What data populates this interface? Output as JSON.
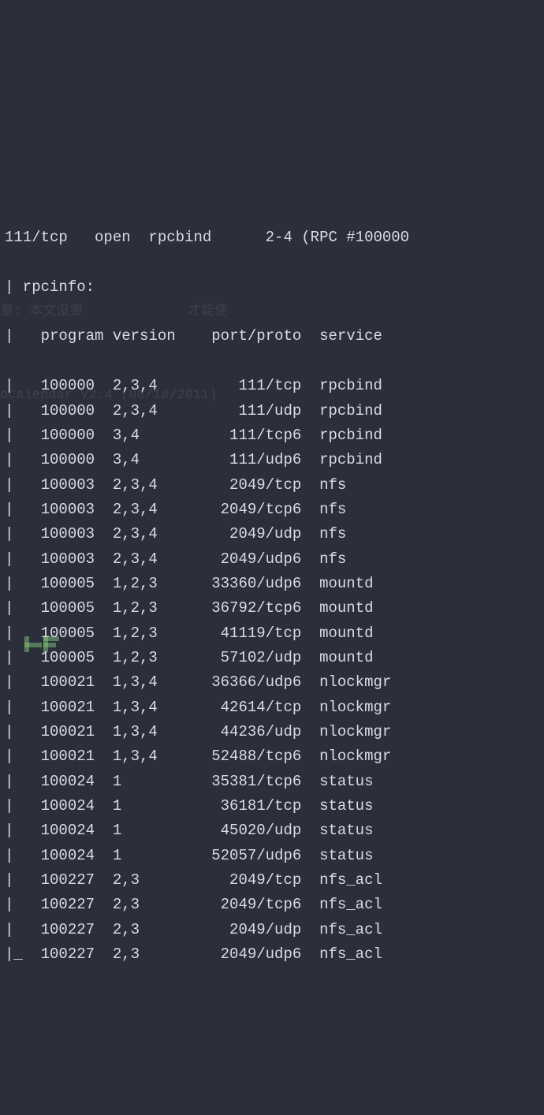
{
  "header": "111/tcp   open  rpcbind      2-4 (RPC #100000",
  "subheader": "| rpcinfo: ",
  "col": {
    "program": "program",
    "version": "version",
    "portproto": "port/proto",
    "service": "service"
  },
  "rows": [
    {
      "program": "100000",
      "version": "2,3,4",
      "portproto": "111/tcp",
      "service": "rpcbind"
    },
    {
      "program": "100000",
      "version": "2,3,4",
      "portproto": "111/udp",
      "service": "rpcbind"
    },
    {
      "program": "100000",
      "version": "3,4",
      "portproto": "111/tcp6",
      "service": "rpcbind"
    },
    {
      "program": "100000",
      "version": "3,4",
      "portproto": "111/udp6",
      "service": "rpcbind"
    },
    {
      "program": "100003",
      "version": "2,3,4",
      "portproto": "2049/tcp",
      "service": "nfs"
    },
    {
      "program": "100003",
      "version": "2,3,4",
      "portproto": "2049/tcp6",
      "service": "nfs"
    },
    {
      "program": "100003",
      "version": "2,3,4",
      "portproto": "2049/udp",
      "service": "nfs"
    },
    {
      "program": "100003",
      "version": "2,3,4",
      "portproto": "2049/udp6",
      "service": "nfs"
    },
    {
      "program": "100005",
      "version": "1,2,3",
      "portproto": "33360/udp6",
      "service": "mountd"
    },
    {
      "program": "100005",
      "version": "1,2,3",
      "portproto": "36792/tcp6",
      "service": "mountd"
    },
    {
      "program": "100005",
      "version": "1,2,3",
      "portproto": "41119/tcp",
      "service": "mountd"
    },
    {
      "program": "100005",
      "version": "1,2,3",
      "portproto": "57102/udp",
      "service": "mountd"
    },
    {
      "program": "100021",
      "version": "1,3,4",
      "portproto": "36366/udp6",
      "service": "nlockmgr"
    },
    {
      "program": "100021",
      "version": "1,3,4",
      "portproto": "42614/tcp",
      "service": "nlockmgr"
    },
    {
      "program": "100021",
      "version": "1,3,4",
      "portproto": "44236/udp",
      "service": "nlockmgr"
    },
    {
      "program": "100021",
      "version": "1,3,4",
      "portproto": "52488/tcp6",
      "service": "nlockmgr"
    },
    {
      "program": "100024",
      "version": "1",
      "portproto": "35381/tcp6",
      "service": "status"
    },
    {
      "program": "100024",
      "version": "1",
      "portproto": "36181/tcp",
      "service": "status"
    },
    {
      "program": "100024",
      "version": "1",
      "portproto": "45020/udp",
      "service": "status"
    },
    {
      "program": "100024",
      "version": "1",
      "portproto": "52057/udp6",
      "service": "status"
    },
    {
      "program": "100227",
      "version": "2,3",
      "portproto": "2049/tcp",
      "service": "nfs_acl"
    },
    {
      "program": "100227",
      "version": "2,3",
      "portproto": "2049/tcp6",
      "service": "nfs_acl"
    },
    {
      "program": "100227",
      "version": "2,3",
      "portproto": "2049/udp",
      "service": "nfs_acl"
    },
    {
      "program": "100227",
      "version": "2,3",
      "portproto": "2049/udp6",
      "service": "nfs_acl"
    }
  ],
  "watermarks": {
    "w1": "意: 本文没要",
    "w1b": "才能使",
    "w2": "oCalendar V2.4 (08/18/2011)"
  }
}
